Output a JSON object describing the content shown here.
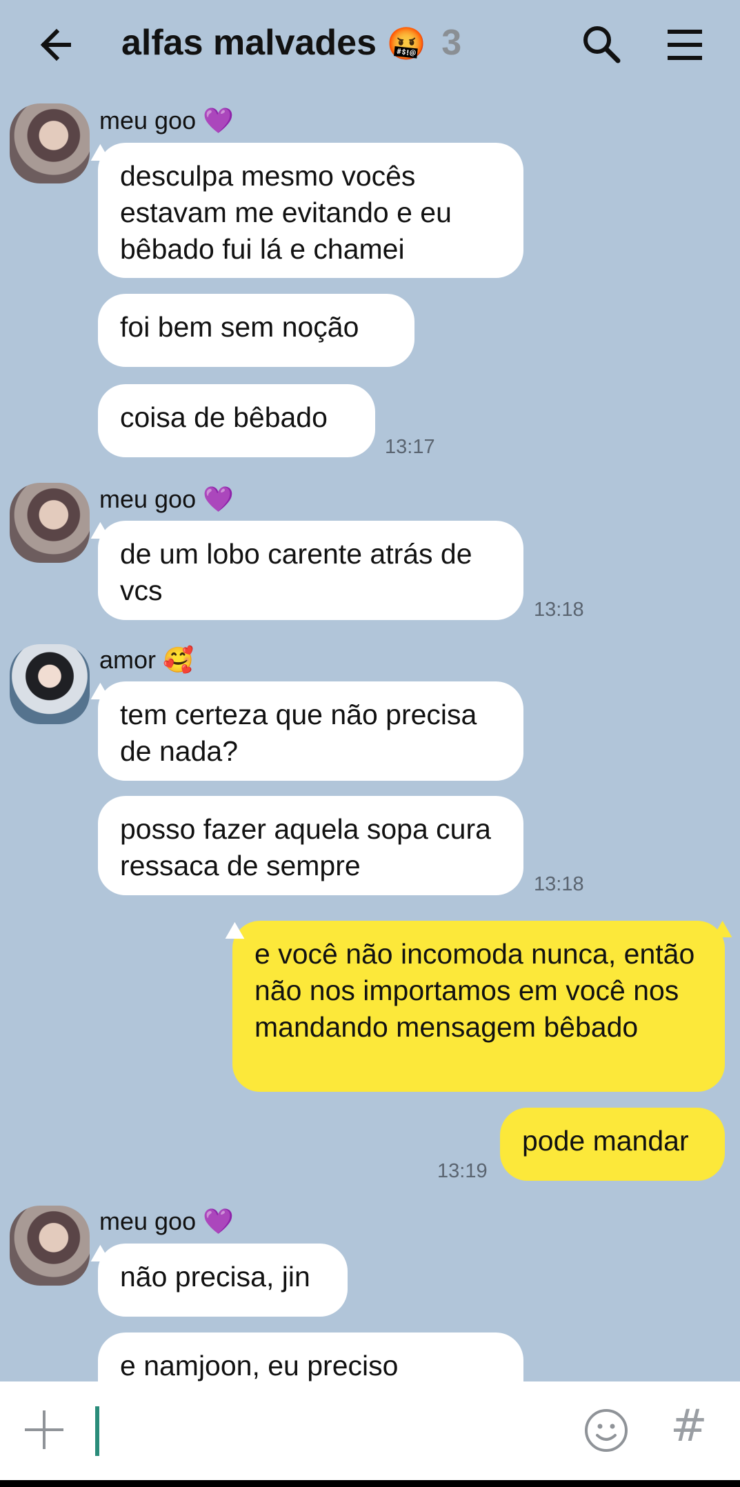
{
  "header": {
    "title": "alfas malvades",
    "title_emoji": "🤬",
    "member_count": "3"
  },
  "messages": [
    {
      "sender": "meu goo",
      "sender_emoji": "💜",
      "texts": [
        "desculpa mesmo vocês estavam me evitando e eu bêbado fui lá e chamei",
        "foi bem sem noção",
        "coisa de bêbado"
      ],
      "time": "13:17"
    },
    {
      "sender": "meu goo",
      "sender_emoji": "💜",
      "texts": [
        "de um lobo carente atrás de vcs"
      ],
      "time": "13:18"
    },
    {
      "sender": "amor",
      "sender_emoji": "🥰",
      "texts": [
        "tem certeza que não precisa de nada?",
        "posso fazer aquela sopa cura ressaca de sempre"
      ],
      "time": "13:18"
    },
    {
      "sender": "me",
      "texts": [
        "e você não incomoda nunca, então não nos importamos em você nos mandando mensagem bêbado",
        "pode mandar"
      ],
      "time": "13:19"
    },
    {
      "sender": "meu goo",
      "sender_emoji": "💜",
      "texts": [
        "não precisa, jin",
        "e namjoon, eu preciso"
      ]
    }
  ],
  "input": {
    "value": "",
    "placeholder": ""
  },
  "colors": {
    "background": "#b1c5d9",
    "my_bubble": "#fce83a",
    "their_bubble": "#ffffff",
    "caret": "#2a8c7a"
  },
  "icons": [
    "back-arrow-icon",
    "search-icon",
    "menu-icon",
    "plus-icon",
    "emoji-icon",
    "hashtag-icon"
  ]
}
